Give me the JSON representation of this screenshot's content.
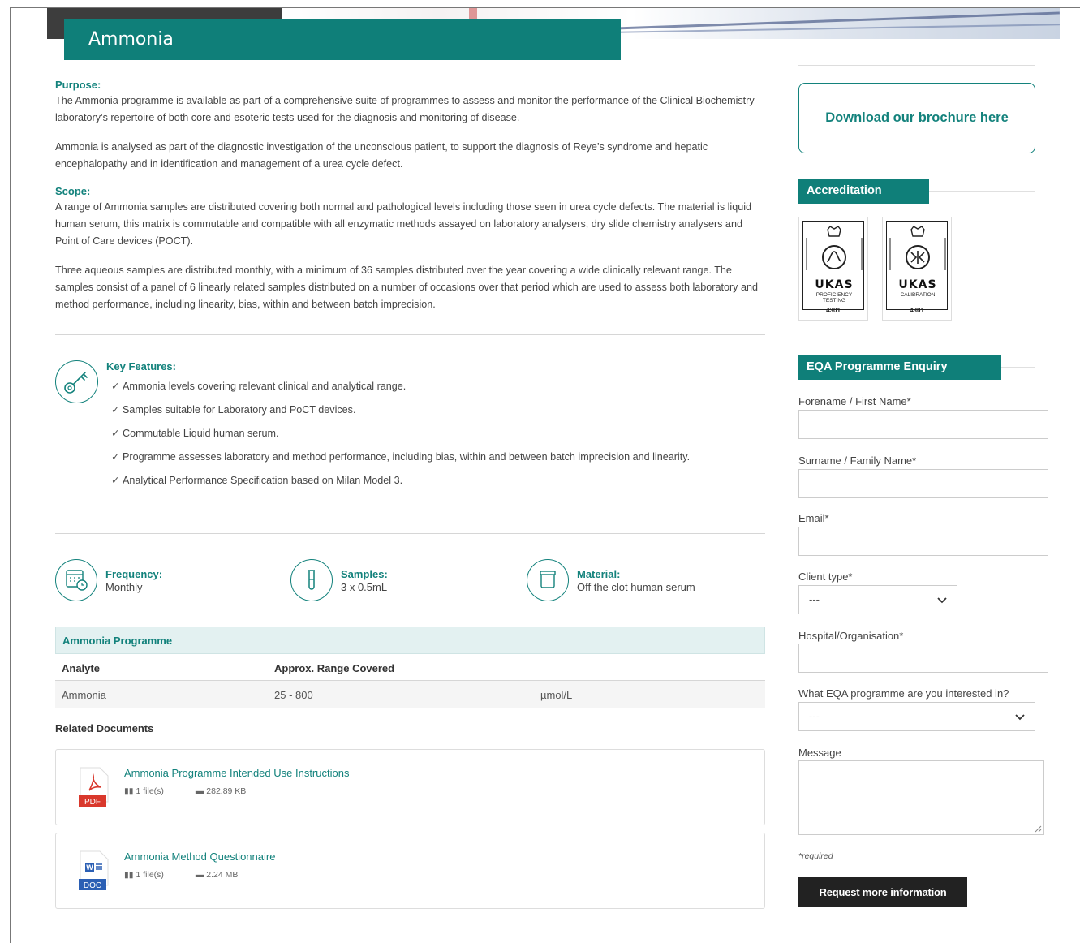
{
  "title": "Ammonia",
  "purpose": {
    "heading": "Purpose:",
    "p1": "The Ammonia programme is available as part of a comprehensive suite of programmes to assess and monitor the performance of the Clinical Biochemistry laboratory’s repertoire of both core and esoteric tests used for the diagnosis and monitoring of disease.",
    "p2": "Ammonia is analysed as part of the diagnostic investigation of the unconscious patient, to support the diagnosis of Reye’s syndrome and hepatic encephalopathy and in identification and management of a urea cycle defect."
  },
  "scope": {
    "heading": "Scope:",
    "p1": "A range of Ammonia samples are distributed covering both normal and pathological levels including those seen in urea cycle defects. The material is liquid human serum, this matrix is commutable and compatible with all enzymatic methods assayed on laboratory analysers, dry slide chemistry analysers and Point of Care devices (POCT).",
    "p2": "Three aqueous samples are distributed monthly, with a minimum of 36 samples distributed over the year covering a wide clinically relevant range. The samples consist of a panel of 6 linearly related samples distributed on a number of occasions over that period which are used to assess both laboratory and method performance, including linearity, bias, within and between batch imprecision."
  },
  "features": {
    "heading": "Key Features:",
    "icon": "key-icon",
    "tick": "✓",
    "items": [
      "Ammonia levels covering relevant clinical and analytical range.",
      "Samples suitable for Laboratory and PoCT devices.",
      "Commutable Liquid human serum.",
      "Programme assesses laboratory and method performance, including bias, within and between batch imprecision and linearity.",
      "Analytical Performance Specification based on Milan Model 3."
    ]
  },
  "stats": [
    {
      "label": "Frequency:",
      "value": "Monthly",
      "icon": "calendar-clock-icon"
    },
    {
      "label": "Samples:",
      "value": "3 x 0.5mL",
      "icon": "test-tube-icon"
    },
    {
      "label": "Material:",
      "value": "Off the clot human serum",
      "icon": "container-icon"
    }
  ],
  "programme_table": {
    "caption": "Ammonia Programme",
    "headers": [
      "Analyte",
      "Approx. Range Covered",
      ""
    ],
    "rows": [
      [
        "Ammonia",
        "25 - 800",
        "µmol/L"
      ]
    ]
  },
  "related": {
    "heading": "Related Documents",
    "docs": [
      {
        "title": "Ammonia Programme Intended Use Instructions",
        "files": "1 file(s)",
        "size": "282.89 KB",
        "type": "PDF"
      },
      {
        "title": "Ammonia Method Questionnaire",
        "files": "1 file(s)",
        "size": "2.24 MB",
        "type": "DOC"
      }
    ]
  },
  "sidebar": {
    "brochure": "Download our brochure here",
    "accreditation": "Accreditation",
    "ukas": [
      {
        "word": "UKAS",
        "sub1": "PROFICIENCY",
        "sub2": "TESTING",
        "num": "4301"
      },
      {
        "word": "UKAS",
        "sub1": "CALIBRATION",
        "sub2": "",
        "num": "4301"
      }
    ],
    "enquiry": "EQA Programme Enquiry",
    "fields": {
      "forename": "Forename / First Name*",
      "surname": "Surname / Family Name*",
      "email": "Email*",
      "client_type": "Client type*",
      "client_type_value": "---",
      "hospital": "Hospital/Organisation*",
      "programme": "What EQA programme are you interested in?",
      "programme_value": "---",
      "message": "Message"
    },
    "required": "*required",
    "submit": "Request more information"
  },
  "colors": {
    "accent": "#0f7f79",
    "accent_text": "#13827c",
    "dark": "#222222"
  }
}
